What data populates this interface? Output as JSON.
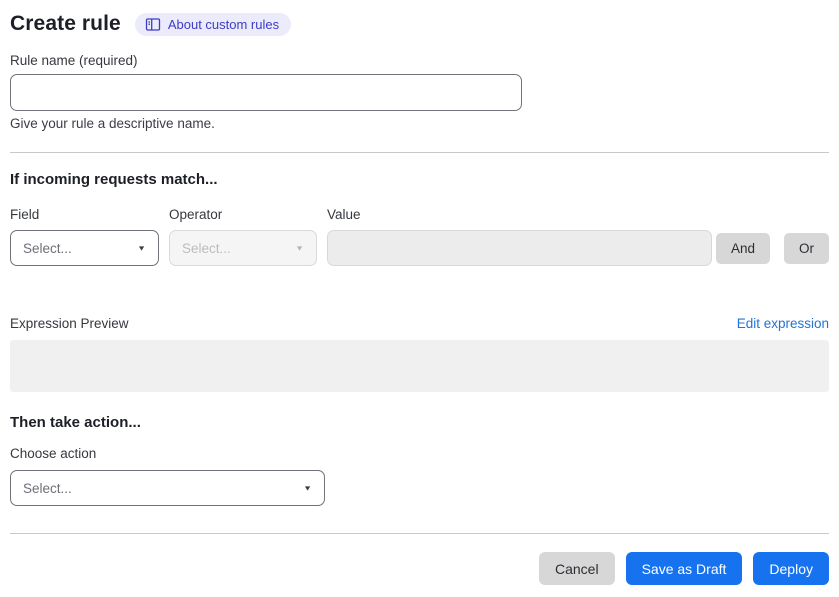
{
  "header": {
    "title": "Create rule",
    "about_link": "About custom rules"
  },
  "rule_name": {
    "label": "Rule name (required)",
    "value": "",
    "helper": "Give your rule a descriptive name."
  },
  "match_section": {
    "heading": "If incoming requests match...",
    "field": {
      "label": "Field",
      "placeholder": "Select..."
    },
    "operator": {
      "label": "Operator",
      "placeholder": "Select..."
    },
    "value": {
      "label": "Value",
      "value": ""
    },
    "and_label": "And",
    "or_label": "Or",
    "expression_preview_label": "Expression Preview",
    "edit_expression_label": "Edit expression",
    "expression_value": ""
  },
  "action_section": {
    "heading": "Then take action...",
    "choose_label": "Choose action",
    "placeholder": "Select..."
  },
  "footer": {
    "cancel": "Cancel",
    "save_draft": "Save as Draft",
    "deploy": "Deploy"
  },
  "colors": {
    "primary_button": "#1672ef",
    "link": "#2374d4",
    "badge_bg": "#ecebfc",
    "badge_text": "#3d3dc4",
    "divider": "#c9c9c9",
    "disabled_bg": "#f5f5f5",
    "preview_bg": "#f0f0f0",
    "gray_button_bg": "#d7d7d7"
  },
  "icons": {
    "about": "book-icon",
    "dropdown": "chevron-down-icon"
  }
}
